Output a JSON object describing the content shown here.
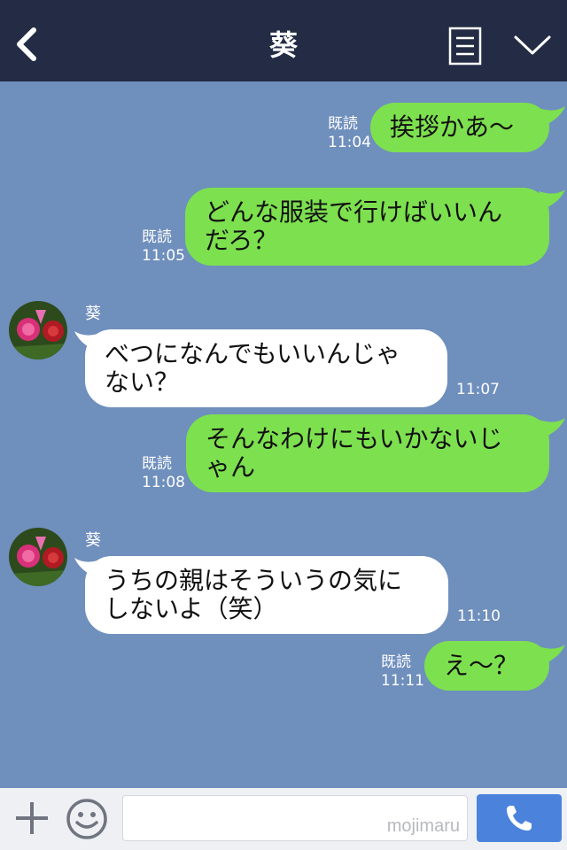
{
  "header": {
    "title": "葵",
    "back_icon": "chevron-left-icon",
    "menu_icon": "menu-list-icon",
    "collapse_icon": "chevron-down-icon"
  },
  "colors": {
    "header_bg": "#232c44",
    "chat_bg": "#6f8fbd",
    "my_bubble": "#7de04f",
    "their_bubble": "#ffffff",
    "call_button": "#4b83dc"
  },
  "messages": [
    {
      "from": "me",
      "lines": [
        "挨拶かあ～"
      ],
      "read": "既読",
      "time": "11:04"
    },
    {
      "from": "me",
      "lines": [
        "どんな服装で行けばいいん",
        "だろ？"
      ],
      "read": "既読",
      "time": "11:05"
    },
    {
      "from": "them",
      "sender": "葵",
      "lines": [
        "べつになんでもいいんじゃ",
        "ない？"
      ],
      "time": "11:07"
    },
    {
      "from": "me",
      "lines": [
        "そんなわけにもいかないじ",
        "ゃん"
      ],
      "read": "既読",
      "time": "11:08"
    },
    {
      "from": "them",
      "sender": "葵",
      "lines": [
        "うちの親はそういうの気に",
        "しないよ（笑）"
      ],
      "time": "11:10"
    },
    {
      "from": "me",
      "lines": [
        "え～？"
      ],
      "read": "既読",
      "time": "11:11"
    }
  ],
  "footer": {
    "plus_icon": "plus-icon",
    "emoji_icon": "smiley-icon",
    "input_value": "",
    "watermark": "mojimaru",
    "call_icon": "phone-icon"
  }
}
